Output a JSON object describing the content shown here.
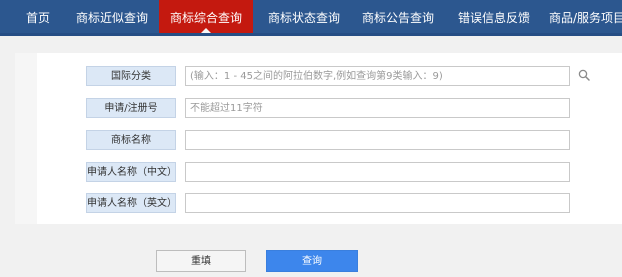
{
  "nav": {
    "items": [
      {
        "label": "首页"
      },
      {
        "label": "商标近似查询"
      },
      {
        "label": "商标综合查询",
        "active": true
      },
      {
        "label": "商标状态查询"
      },
      {
        "label": "商标公告查询"
      },
      {
        "label": "错误信息反馈"
      },
      {
        "label": "商品/服务项目"
      }
    ]
  },
  "form": {
    "international_class": {
      "label": "国际分类",
      "placeholder": "(输入：1 - 45之间的阿拉伯数字,例如查询第9类输入：9)",
      "value": ""
    },
    "registration_number": {
      "label": "申请/注册号",
      "placeholder": "不能超过11字符",
      "value": ""
    },
    "trademark_name": {
      "label": "商标名称",
      "placeholder": "",
      "value": ""
    },
    "applicant_name_cn": {
      "label": "申请人名称（中文）",
      "placeholder": "",
      "value": ""
    },
    "applicant_name_en": {
      "label": "申请人名称（英文）",
      "placeholder": "",
      "value": ""
    }
  },
  "buttons": {
    "reset": "重填",
    "query": "查询"
  },
  "colors": {
    "nav_background": "#2c578f",
    "nav_active": "#c4190f",
    "label_background": "#dce8f6",
    "query_button": "#3d86ec"
  },
  "icons": {
    "search": "search-icon"
  }
}
